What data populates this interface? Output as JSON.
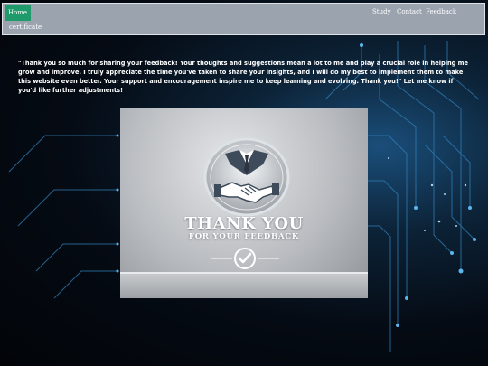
{
  "nav": {
    "home": "Home",
    "links": [
      "Study",
      "Contact",
      "Feedback"
    ],
    "certificate": "certificate"
  },
  "message": "\"Thank you so much for sharing your feedback! Your thoughts and suggestions mean a lot to me and play a crucial role in helping me grow and improve. I truly appreciate the time you've taken to share your insights, and I will do my best to implement them to make this website even better. Your support and encouragement inspire me to keep learning and evolving. Thank you!\" Let me know if you'd like further adjustments!",
  "image": {
    "title": "THANK YOU",
    "subtitle": "FOR YOUR FEEDBACK",
    "icons": [
      "suit-handshake-emblem-icon",
      "checkmark-circle-icon"
    ]
  },
  "colors": {
    "nav_bg": "#9aa3ae",
    "home_bg": "#1f9a6a",
    "text": "#ffffff"
  }
}
